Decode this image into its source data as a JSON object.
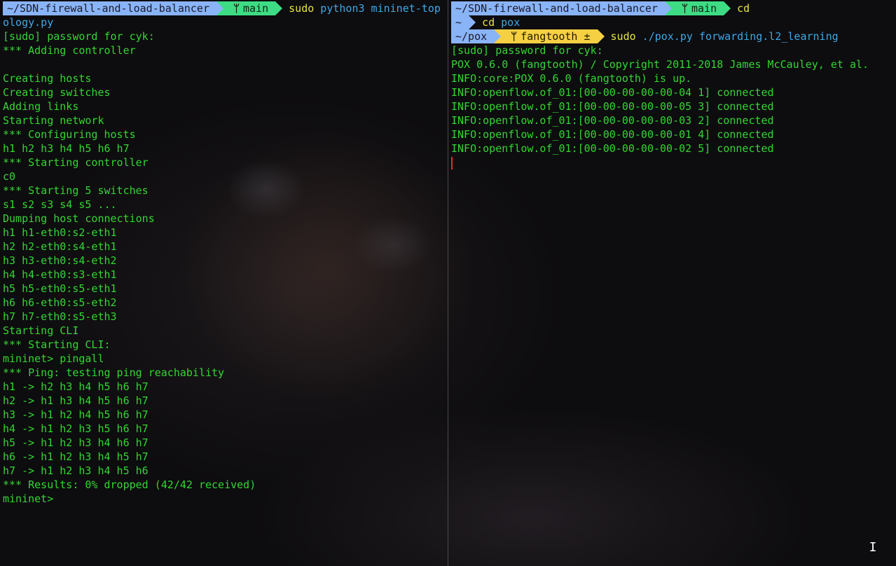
{
  "left_pane": {
    "prompt": {
      "path": "~/SDN-firewall-and-load-balancer",
      "branch": "main",
      "branch_icon": "git-branch-icon",
      "command": "sudo",
      "args_line1": " python3 mininet-top",
      "args_line2": "ology.py"
    },
    "output": [
      "[sudo] password for cyk:",
      "*** Adding controller",
      "",
      "Creating hosts",
      "Creating switches",
      "Adding links",
      "Starting network",
      "*** Configuring hosts",
      "h1 h2 h3 h4 h5 h6 h7",
      "*** Starting controller",
      "c0",
      "*** Starting 5 switches",
      "s1 s2 s3 s4 s5 ...",
      "Dumping host connections",
      "h1 h1-eth0:s2-eth1",
      "h2 h2-eth0:s4-eth1",
      "h3 h3-eth0:s4-eth2",
      "h4 h4-eth0:s3-eth1",
      "h5 h5-eth0:s5-eth1",
      "h6 h6-eth0:s5-eth2",
      "h7 h7-eth0:s5-eth3",
      "Starting CLI",
      "*** Starting CLI:",
      "mininet> pingall",
      "*** Ping: testing ping reachability",
      "h1 -> h2 h3 h4 h5 h6 h7",
      "h2 -> h1 h3 h4 h5 h6 h7",
      "h3 -> h1 h2 h4 h5 h6 h7",
      "h4 -> h1 h2 h3 h5 h6 h7",
      "h5 -> h1 h2 h3 h4 h6 h7",
      "h6 -> h1 h2 h3 h4 h5 h7",
      "h7 -> h1 h2 h3 h4 h5 h6",
      "*** Results: 0% dropped (42/42 received)",
      "mininet>"
    ]
  },
  "right_pane": {
    "prompt1": {
      "path": "~/SDN-firewall-and-load-balancer",
      "branch": "main",
      "command": "cd"
    },
    "prompt2": {
      "path": "~",
      "command": "cd",
      "args": " pox"
    },
    "prompt3": {
      "path": "~/pox",
      "branch": "fangtooth",
      "dirty_marker": "±",
      "command": "sudo",
      "args": " ./pox.py forwarding.l2_learning"
    },
    "output": [
      "[sudo] password for cyk:",
      "POX 0.6.0 (fangtooth) / Copyright 2011-2018 James McCauley, et al.",
      "INFO:core:POX 0.6.0 (fangtooth) is up.",
      "INFO:openflow.of_01:[00-00-00-00-00-04 1] connected",
      "INFO:openflow.of_01:[00-00-00-00-00-05 3] connected",
      "INFO:openflow.of_01:[00-00-00-00-00-03 2] connected",
      "INFO:openflow.of_01:[00-00-00-00-00-01 4] connected",
      "INFO:openflow.of_01:[00-00-00-00-00-02 5] connected"
    ]
  },
  "colors": {
    "text_green": "#33d633",
    "command_yellow": "#e6e640",
    "args_blue": "#3fa8e6",
    "path_segment": "#8ab4f8",
    "git_segment": "#3ddc84",
    "git_dirty_segment": "#f5d042",
    "cursor": "#e03030"
  },
  "mouse_cursor": "text-ibeam-icon"
}
